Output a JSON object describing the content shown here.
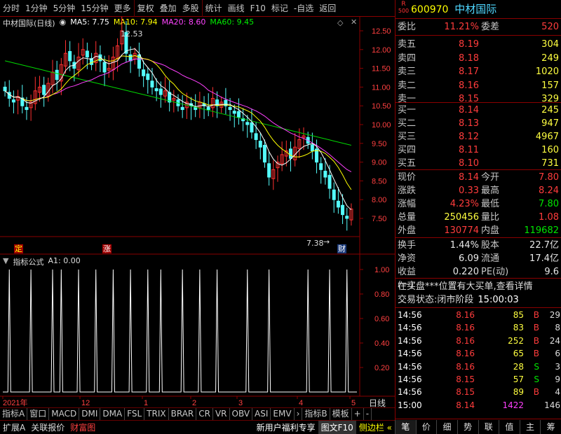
{
  "toolbar": {
    "items": [
      "分时",
      "1分钟",
      "5分钟",
      "15分钟",
      "更多",
      "复权",
      "叠加",
      "多股",
      "统计",
      "画线",
      "F10",
      "标记",
      "-自选",
      "返回"
    ]
  },
  "chart": {
    "title": "中材国际(日线)",
    "ma5": "MA5: 7.75",
    "ma10": "MA10: 7.94",
    "ma20": "MA20: 8.60",
    "ma60": "MA60: 9.45",
    "high_label": "12.53",
    "low_label": "7.38",
    "marker_ding": "定",
    "marker_zhang": "涨",
    "marker_cai": "财",
    "price_ticks": [
      "12.50",
      "12.00",
      "11.50",
      "11.00",
      "10.50",
      "10.00",
      "9.50",
      "9.00",
      "8.50",
      "8.00",
      "7.50"
    ],
    "indicator_title": "指标公式",
    "indicator_value": "A1: 0.00",
    "ind_ticks": [
      "1.00",
      "0.80",
      "0.60",
      "0.40",
      "0.20"
    ],
    "date_labels": [
      "2021年",
      "12",
      "1",
      "2",
      "3",
      "4",
      "5"
    ],
    "period_label": "日线",
    "colors": {
      "ma5": "#ffffff",
      "ma10": "#ffff00",
      "ma20": "#ff40ff",
      "ma60": "#00e000",
      "up": "#ff3030",
      "down": "#54fcfc"
    }
  },
  "chart_data": {
    "type": "candlestick",
    "ylim": [
      7.2,
      12.8
    ],
    "high": 12.53,
    "low": 7.38,
    "closes": [
      10.9,
      10.7,
      10.6,
      10.75,
      10.5,
      10.4,
      10.6,
      10.9,
      11.0,
      10.8,
      11.1,
      11.4,
      11.2,
      11.6,
      11.9,
      11.7,
      11.5,
      11.8,
      12.0,
      11.8,
      11.6,
      11.9,
      11.7,
      11.4,
      11.5,
      11.8,
      12.1,
      12.5,
      11.9,
      11.7,
      11.9,
      11.5,
      11.3,
      11.2,
      11.0,
      10.9,
      10.8,
      10.9,
      10.6,
      10.7,
      10.5,
      10.4,
      10.6,
      10.5,
      10.4,
      10.6,
      10.5,
      10.4,
      10.7,
      10.5,
      10.6,
      10.5,
      10.4,
      10.3,
      10.2,
      10.1,
      10.0,
      9.8,
      9.6,
      9.4,
      9.0,
      8.6,
      8.8,
      9.0,
      9.2,
      9.3,
      9.1,
      9.4,
      9.6,
      9.7,
      9.5,
      9.3,
      9.0,
      8.8,
      8.6,
      8.3,
      8.0,
      7.8,
      7.6,
      7.5,
      7.75
    ],
    "signals": [
      1,
      6,
      11,
      13,
      17,
      21,
      25,
      29,
      33,
      36,
      41,
      45,
      49,
      56,
      61,
      70,
      75,
      79
    ],
    "ma5_last": 7.75,
    "ma10_last": 7.94,
    "ma20_last": 8.6,
    "ma60_last": 9.45
  },
  "quote": {
    "code": "600970",
    "name": "中材国际",
    "logo_top": "R",
    "logo_bottom": "500",
    "rows_top": [
      [
        "委比",
        "11.21%",
        "委差",
        "520"
      ]
    ],
    "sell": [
      [
        "卖五",
        "8.19",
        "304"
      ],
      [
        "卖四",
        "8.18",
        "249"
      ],
      [
        "卖三",
        "8.17",
        "1020"
      ],
      [
        "卖二",
        "8.16",
        "157"
      ],
      [
        "卖一",
        "8.15",
        "329"
      ]
    ],
    "buy": [
      [
        "买一",
        "8.14",
        "245"
      ],
      [
        "买二",
        "8.13",
        "947"
      ],
      [
        "买三",
        "8.12",
        "4967"
      ],
      [
        "买四",
        "8.11",
        "160"
      ],
      [
        "买五",
        "8.10",
        "731"
      ]
    ],
    "stats": [
      [
        "现价",
        "8.14",
        "今开",
        "7.80"
      ],
      [
        "涨跌",
        "0.33",
        "最高",
        "8.24"
      ],
      [
        "涨幅",
        "4.23%",
        "最低",
        "7.80"
      ],
      [
        "总量",
        "250456",
        "量比",
        "1.08"
      ],
      [
        "外盘",
        "130774",
        "内盘",
        "119682"
      ]
    ],
    "stats2": [
      [
        "换手",
        "1.44%",
        "股本",
        "22.7亿"
      ],
      [
        "净资",
        "6.09",
        "流通",
        "17.4亿"
      ],
      [
        "收益(一)",
        "0.220",
        "PE(动)",
        "9.6"
      ]
    ],
    "notice": "在买盘***位置有大买单,查看详情",
    "trade_status_label": "交易状态:",
    "trade_status": "闭市阶段",
    "trade_time": "15:00:03",
    "ticks": [
      [
        "14:56",
        "8.16",
        "85",
        "B",
        "29"
      ],
      [
        "14:56",
        "8.16",
        "83",
        "B",
        "8"
      ],
      [
        "14:56",
        "8.16",
        "252",
        "B",
        "24"
      ],
      [
        "14:56",
        "8.16",
        "65",
        "B",
        "6"
      ],
      [
        "14:56",
        "8.16",
        "28",
        "S",
        "3"
      ],
      [
        "14:56",
        "8.15",
        "57",
        "S",
        "9"
      ],
      [
        "14:56",
        "8.15",
        "89",
        "B",
        "4"
      ],
      [
        "15:00",
        "8.14",
        "1422",
        "",
        "146"
      ]
    ]
  },
  "bottom": {
    "indicators": [
      "指标A",
      "窗口",
      "MACD",
      "DMI",
      "DMA",
      "FSL",
      "TRIX",
      "BRAR",
      "CR",
      "VR",
      "OBV",
      "ASI",
      "EMV",
      "›",
      "指标B",
      "模板",
      "+",
      "-"
    ],
    "status": [
      "扩展A",
      "关联报价",
      "财富图"
    ],
    "promo": "新用户福利专享",
    "f10": "图文F10",
    "side": "侧边栏 «",
    "tabs": [
      "笔",
      "价",
      "细",
      "势",
      "联",
      "值",
      "主",
      "筹"
    ]
  }
}
